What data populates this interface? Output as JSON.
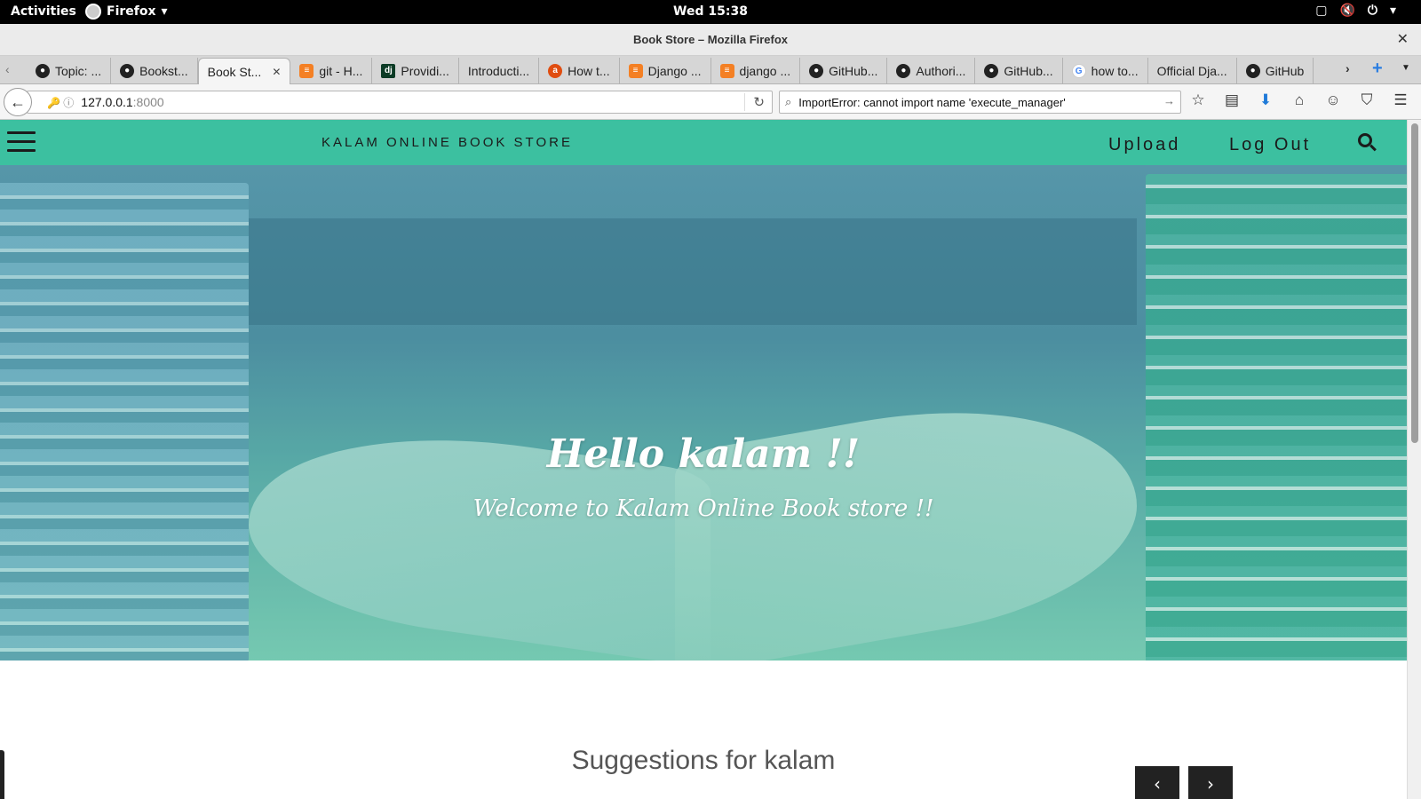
{
  "system": {
    "activities": "Activities",
    "app_menu": "Firefox",
    "clock": "Wed 15:38"
  },
  "window": {
    "title": "Book Store – Mozilla Firefox"
  },
  "tabs": [
    {
      "label": "Topic: ...",
      "favicon": "github-icon"
    },
    {
      "label": "Bookst...",
      "favicon": "github-icon"
    },
    {
      "label": "Book St...",
      "favicon": "",
      "active": true
    },
    {
      "label": "git - H...",
      "favicon": "stackoverflow-icon"
    },
    {
      "label": "Providi...",
      "favicon": "django-icon"
    },
    {
      "label": "Introducti...",
      "favicon": ""
    },
    {
      "label": "How t...",
      "favicon": "ask-icon"
    },
    {
      "label": "Django ...",
      "favicon": "stackoverflow-icon"
    },
    {
      "label": "django ...",
      "favicon": "stackoverflow-icon"
    },
    {
      "label": "GitHub...",
      "favicon": "github-icon"
    },
    {
      "label": "Authori...",
      "favicon": "github-icon"
    },
    {
      "label": "GitHub...",
      "favicon": "github-icon"
    },
    {
      "label": "how to...",
      "favicon": "google-icon"
    },
    {
      "label": "Official Dja...",
      "favicon": ""
    },
    {
      "label": "GitHub",
      "favicon": "github-icon"
    }
  ],
  "navbar": {
    "url_host": "127.0.0.1",
    "url_port": ":8000",
    "search_value": "ImportError: cannot import name 'execute_manager'"
  },
  "site": {
    "brand": "KALAM ONLINE BOOK STORE",
    "upload": "Upload",
    "logout": "Log Out",
    "hero_title": "Hello kalam !!",
    "hero_subtitle": "Welcome to Kalam Online Book store !!",
    "suggestions_title": "Suggestions for kalam",
    "accent_color": "#3cc0a0"
  }
}
